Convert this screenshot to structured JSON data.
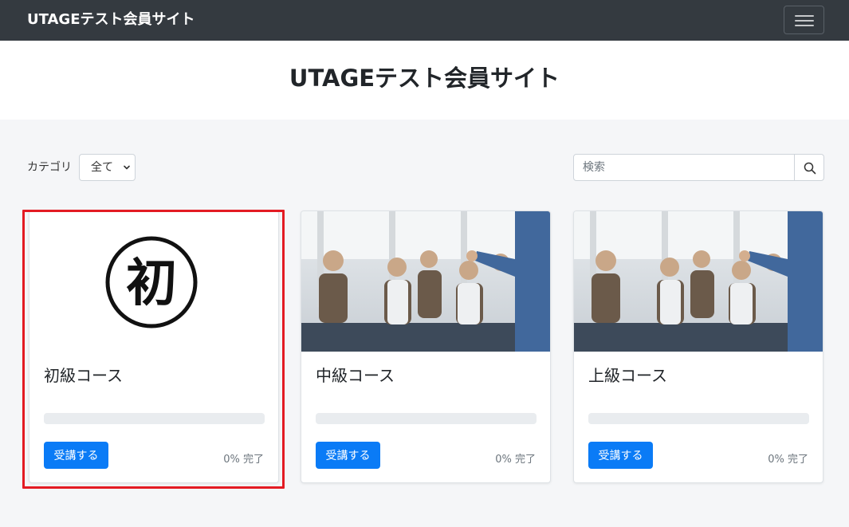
{
  "navbar": {
    "brand": "UTAGEテスト会員サイト",
    "toggle_icon": "hamburger-icon"
  },
  "hero": {
    "title": "UTAGEテスト会員サイト"
  },
  "filters": {
    "category_label": "カテゴリ",
    "category_selected": "全て",
    "search_placeholder": "検索",
    "search_icon": "search-icon"
  },
  "courses": [
    {
      "title": "初級コース",
      "button_label": "受講する",
      "progress_percent": 0,
      "progress_text": "0%",
      "complete_label": "完了",
      "thumbnail": "初",
      "highlighted": true
    },
    {
      "title": "中級コース",
      "button_label": "受講する",
      "progress_percent": 0,
      "progress_text": "0%",
      "complete_label": "完了",
      "thumbnail": "seminar-photo"
    },
    {
      "title": "上級コース",
      "button_label": "受講する",
      "progress_percent": 0,
      "progress_text": "0%",
      "complete_label": "完了",
      "thumbnail": "seminar-photo"
    }
  ],
  "colors": {
    "navbar_bg": "#343a40",
    "primary": "#0a7bf6",
    "highlight": "#e31b23",
    "page_bg": "#f5f6f8"
  }
}
